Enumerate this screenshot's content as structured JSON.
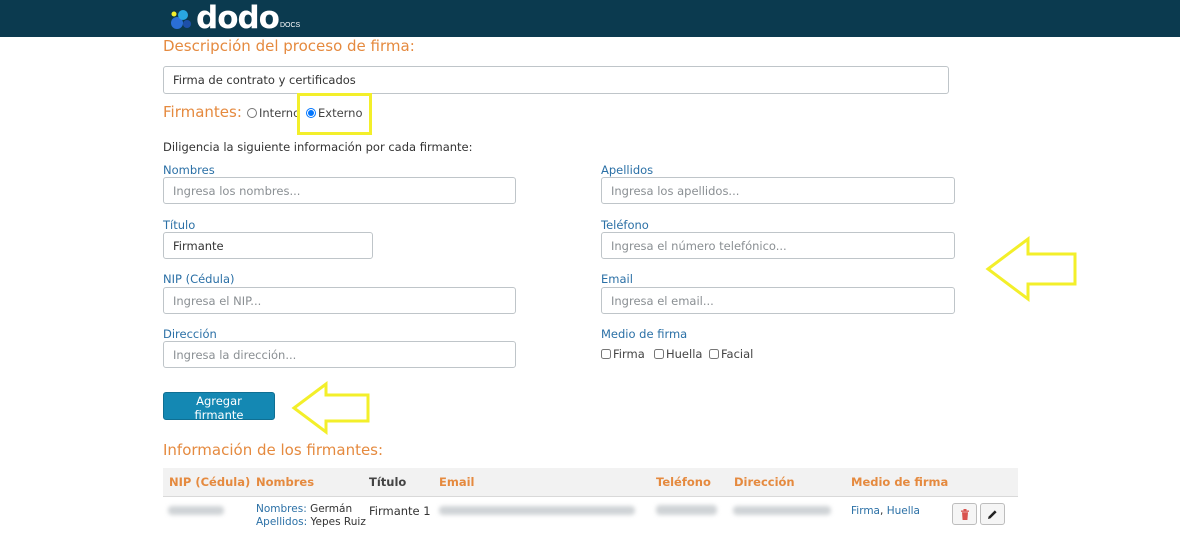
{
  "brand": {
    "logo_text": "dodo",
    "logo_sub": "DOCS"
  },
  "process": {
    "title": "Descripción del proceso de firma:",
    "description_value": "Firma de contrato y certificados"
  },
  "signers": {
    "label": "Firmantes:",
    "options": [
      "Interno",
      "Externo"
    ],
    "selected": "Externo",
    "instructions": "Diligencia la siguiente información por cada firmante:"
  },
  "form": {
    "nombres": {
      "label": "Nombres",
      "placeholder": "Ingresa los nombres..."
    },
    "apellidos": {
      "label": "Apellidos",
      "placeholder": "Ingresa los apellidos..."
    },
    "titulo": {
      "label": "Título",
      "value": "Firmante"
    },
    "telefono": {
      "label": "Teléfono",
      "placeholder": "Ingresa el número telefónico..."
    },
    "nip": {
      "label": "NIP (Cédula)",
      "placeholder": "Ingresa el NIP..."
    },
    "email": {
      "label": "Email",
      "placeholder": "Ingresa el email..."
    },
    "direccion": {
      "label": "Dirección",
      "placeholder": "Ingresa la dirección..."
    },
    "medio": {
      "label": "Medio de firma",
      "options": [
        "Firma",
        "Huella",
        "Facial"
      ]
    }
  },
  "add_button": "Agregar firmante",
  "table": {
    "title": "Información de los firmantes:",
    "headers": [
      "NIP (Cédula)",
      "Nombres",
      "Título",
      "Email",
      "Teléfono",
      "Dirección",
      "Medio de firma"
    ],
    "rows": [
      {
        "nombres_label": "Nombres:",
        "nombres_value": "Germán",
        "apellidos_label": "Apellidos:",
        "apellidos_value": "Yepes Ruiz",
        "titulo": "Firmante 1",
        "medio_1": "Firma",
        "medio_sep": ",",
        "medio_2": "Huella"
      }
    ]
  },
  "colors": {
    "accent": "#e58a3f",
    "label": "#2b70a6",
    "header": "#0b3a4f",
    "button": "#1488b3",
    "highlight": "#f3ef2a"
  }
}
